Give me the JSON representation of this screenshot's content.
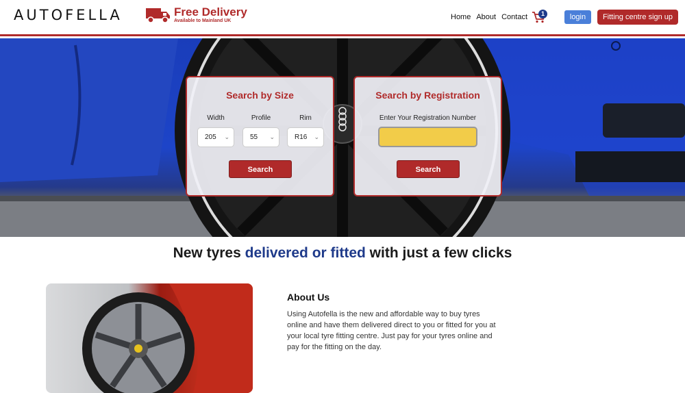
{
  "header": {
    "logo": "AUTOFELLA",
    "delivery_title": "Free Delivery",
    "delivery_sub": "Available to Mainland UK",
    "nav": [
      "Home",
      "About",
      "Contact"
    ],
    "cart_count": "1",
    "login_label": "login",
    "signup_label": "Fitting centre sign up"
  },
  "size_search": {
    "title": "Search by Size",
    "width_label": "Width",
    "profile_label": "Profile",
    "rim_label": "Rim",
    "width_value": "205",
    "profile_value": "55",
    "rim_value": "R16",
    "button": "Search"
  },
  "reg_search": {
    "title": "Search by Registration",
    "input_label": "Enter Your Registration Number",
    "input_value": "",
    "button": "Search"
  },
  "tagline": {
    "part1": "New tyres ",
    "highlight": "delivered or fitted",
    "part2": " with just a few clicks"
  },
  "about": {
    "title": "About Us",
    "text": "Using Autofella is the new and affordable way to buy tyres online and have them delivered direct to you or fitted for you at your local tyre fitting centre. Just pay for your tyres online and pay for the fitting on the day."
  },
  "colors": {
    "brand_red": "#b02a2a",
    "brand_blue": "#1e3a8a",
    "login_blue": "#4a7fd9",
    "plate_yellow": "#f2cc49"
  },
  "icons": {
    "truck": "delivery-truck-icon",
    "cart": "shopping-cart-icon",
    "chevron": "chevron-down-icon"
  }
}
